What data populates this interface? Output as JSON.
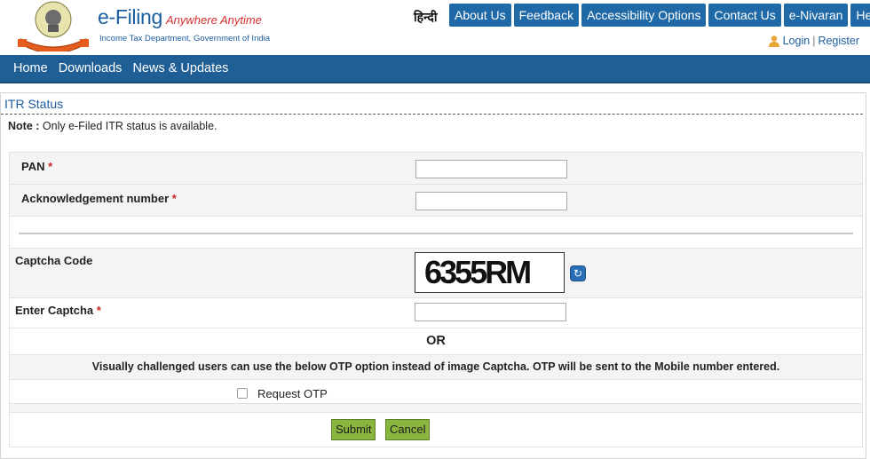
{
  "header": {
    "brand_title": "e-Filing",
    "brand_tagline": "Anywhere Anytime",
    "brand_subtitle": "Income Tax Department, Government of India",
    "hindi_link": "हिन्दी",
    "topnav": [
      "About Us",
      "Feedback",
      "Accessibility Options",
      "Contact Us",
      "e-Nivaran",
      "Help"
    ],
    "login": "Login",
    "separator": "|",
    "register": "Register"
  },
  "mainnav": [
    "Home",
    "Downloads",
    "News & Updates"
  ],
  "page": {
    "title": "ITR Status",
    "note_label": "Note :",
    "note_text": " Only e-Filed ITR status is available."
  },
  "form": {
    "pan_label": "PAN",
    "ack_label": "Acknowledgement number",
    "required_mark": "*",
    "captcha_label": "Captcha Code",
    "captcha_value": "6355RM",
    "enter_captcha_label": "Enter Captcha",
    "or_text": "OR",
    "otp_info": "Visually challenged users can use the below OTP option instead of image Captcha. OTP will be sent to the Mobile number entered.",
    "request_otp_label": "Request OTP",
    "submit_label": "Submit",
    "cancel_label": "Cancel"
  },
  "colors": {
    "nav_blue": "#1f5f95",
    "button_green": "#8ab53e",
    "required_red": "#c62828"
  }
}
